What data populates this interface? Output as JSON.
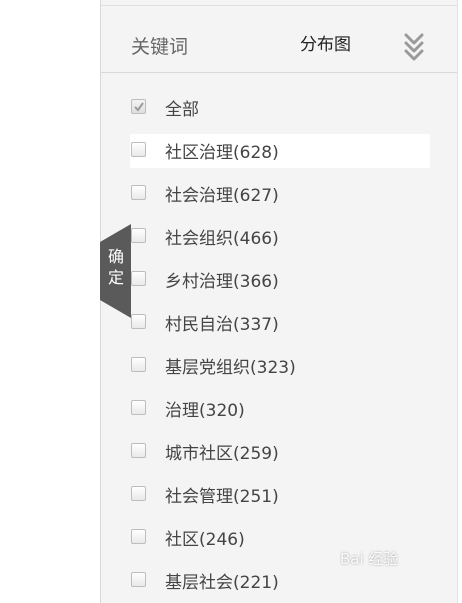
{
  "header": {
    "keyword_label": "关键词",
    "distribution_label": "分布图"
  },
  "confirm": {
    "label_1": "确",
    "label_2": "定"
  },
  "items": [
    {
      "label": "全部",
      "checked": true
    },
    {
      "label": "社区治理(628)",
      "checked": false
    },
    {
      "label": "社会治理(627)",
      "checked": false
    },
    {
      "label": "社会组织(466)",
      "checked": false
    },
    {
      "label": "乡村治理(366)",
      "checked": false
    },
    {
      "label": "村民自治(337)",
      "checked": false
    },
    {
      "label": "基层党组织(323)",
      "checked": false
    },
    {
      "label": "治理(320)",
      "checked": false
    },
    {
      "label": "城市社区(259)",
      "checked": false
    },
    {
      "label": "社会管理(251)",
      "checked": false
    },
    {
      "label": "社区(246)",
      "checked": false
    },
    {
      "label": "基层社会(221)",
      "checked": false
    }
  ],
  "watermark": "Bai 经验",
  "colors": {
    "panel_bg": "#f4f4f4",
    "tab_bg": "#5a5a5a"
  }
}
